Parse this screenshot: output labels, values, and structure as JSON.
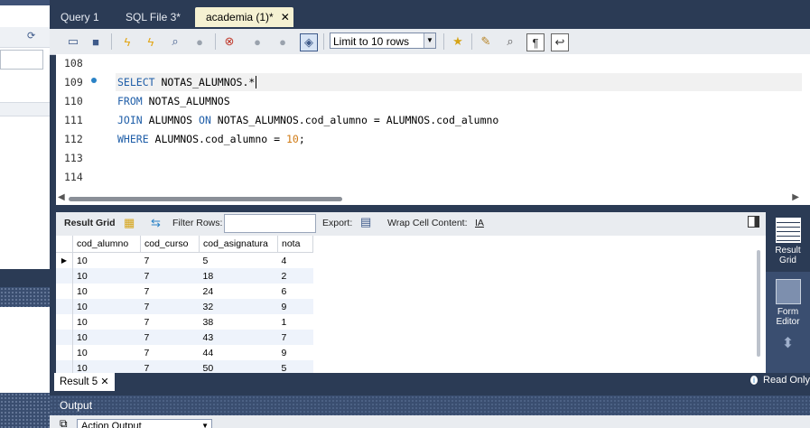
{
  "tabs": [
    {
      "label": "Query 1",
      "active": false
    },
    {
      "label": "SQL File 3*",
      "active": false
    },
    {
      "label": "academia (1)*",
      "active": true
    }
  ],
  "toolbar": {
    "limit_select": "Limit to 10 rows",
    "icons": [
      "open-folder-icon",
      "save-icon",
      "execute-icon",
      "execute-current-icon",
      "explain-icon",
      "stop-icon",
      "toggle-error-icon",
      "commit-icon",
      "rollback-icon",
      "autocommit-icon",
      "bookmark-star-icon",
      "beautify-icon",
      "find-icon",
      "invisible-chars-icon",
      "wrap-icon"
    ]
  },
  "editor": {
    "lines": [
      {
        "num": "108",
        "tokens": []
      },
      {
        "num": "109",
        "tokens": [
          {
            "t": "SELECT",
            "k": "kw"
          },
          {
            "t": " NOTAS_ALUMNOS.*",
            "k": ""
          }
        ]
      },
      {
        "num": "110",
        "tokens": [
          {
            "t": "FROM",
            "k": "kw"
          },
          {
            "t": " NOTAS_ALUMNOS",
            "k": ""
          }
        ]
      },
      {
        "num": "111",
        "tokens": [
          {
            "t": "JOIN",
            "k": "kw"
          },
          {
            "t": " ALUMNOS ",
            "k": ""
          },
          {
            "t": "ON",
            "k": "kw"
          },
          {
            "t": " NOTAS_ALUMNOS.cod_alumno = ALUMNOS.cod_alumno",
            "k": ""
          }
        ]
      },
      {
        "num": "112",
        "tokens": [
          {
            "t": "WHERE",
            "k": "kw"
          },
          {
            "t": " ALUMNOS.cod_alumno = ",
            "k": ""
          },
          {
            "t": "10",
            "k": "num"
          },
          {
            "t": ";",
            "k": ""
          }
        ]
      },
      {
        "num": "113",
        "tokens": []
      },
      {
        "num": "114",
        "tokens": []
      }
    ]
  },
  "result_toolbar": {
    "result_grid_label": "Result Grid",
    "filter_label": "Filter Rows:",
    "export_label": "Export:",
    "wrap_label": "Wrap Cell Content:",
    "wrap_icon_label": "IA"
  },
  "grid": {
    "columns": [
      "cod_alumno",
      "cod_curso",
      "cod_asignatura",
      "nota"
    ],
    "rows": [
      [
        "10",
        "7",
        "5",
        "4"
      ],
      [
        "10",
        "7",
        "18",
        "2"
      ],
      [
        "10",
        "7",
        "24",
        "6"
      ],
      [
        "10",
        "7",
        "32",
        "9"
      ],
      [
        "10",
        "7",
        "38",
        "1"
      ],
      [
        "10",
        "7",
        "43",
        "7"
      ],
      [
        "10",
        "7",
        "44",
        "9"
      ],
      [
        "10",
        "7",
        "50",
        "5"
      ]
    ]
  },
  "side_panel": {
    "result_grid": "Result Grid",
    "form_editor": "Form Editor"
  },
  "result_tab": {
    "label": "Result 5"
  },
  "read_only": "Read Only",
  "output": {
    "title": "Output",
    "select": "Action Output"
  }
}
